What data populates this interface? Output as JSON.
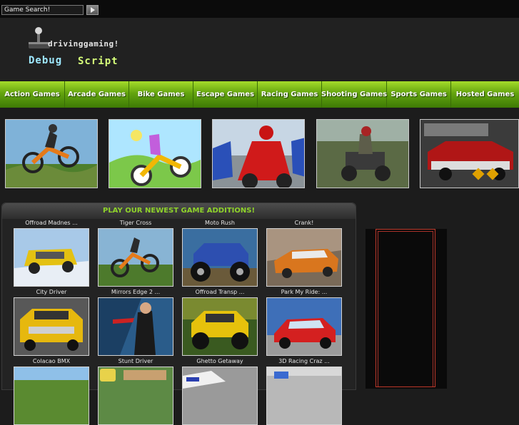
{
  "search": {
    "value": "Game Search!"
  },
  "logo": {
    "site_name": "drivinggaming!",
    "word1": "Debug",
    "word2": "Script"
  },
  "nav": {
    "items": [
      "Action Games",
      "Arcade Games",
      "Bike Games",
      "Escape Games",
      "Racing Games",
      "Shooting Games",
      "Sports Games",
      "Hosted Games"
    ]
  },
  "newest": {
    "heading": "PLAY OUR NEWEST GAME ADDITIONS!",
    "games": [
      "Offroad Madnes ...",
      "Tiger Cross",
      "Moto Rush",
      "Crank!",
      "City Driver",
      "Mirrors Edge 2 ...",
      "Offroad Transp ...",
      "Park My Ride: ...",
      "Colacao BMX",
      "Stunt Driver",
      "Ghetto Getaway",
      "3D Racing Craz ..."
    ]
  },
  "colors": {
    "nav_green": "#63a40f",
    "heading_green": "#8fd32a",
    "ad_border": "#c0392b"
  }
}
